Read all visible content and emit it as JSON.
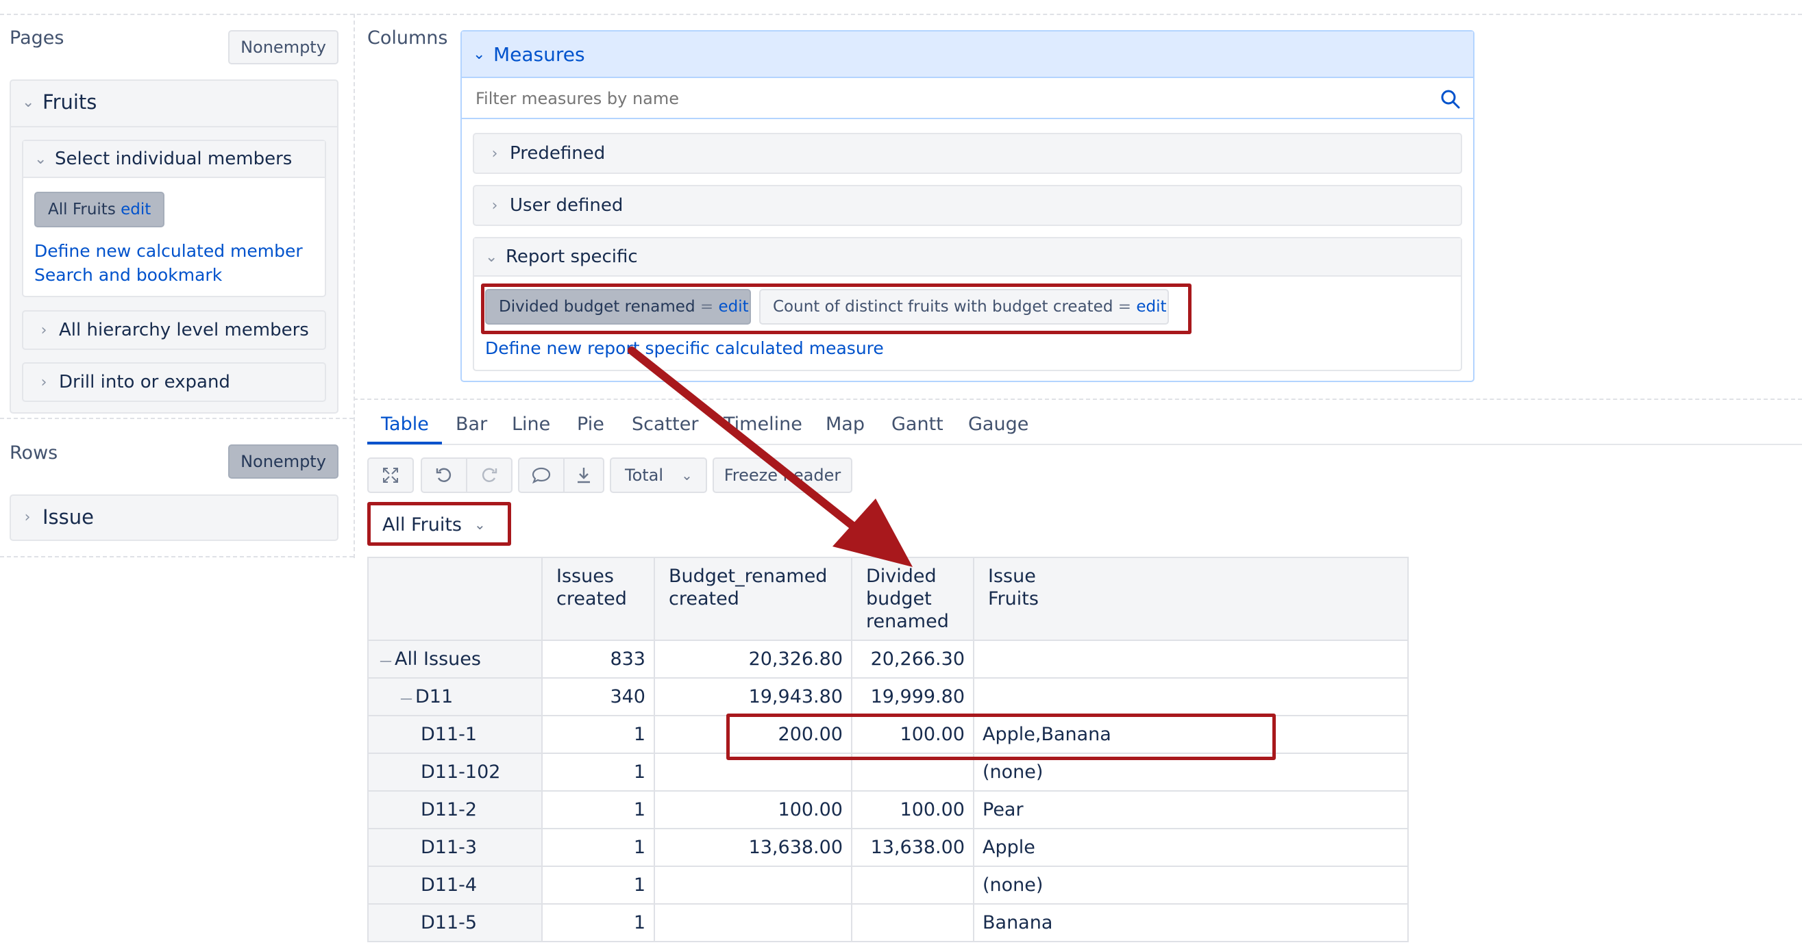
{
  "pages": {
    "label": "Pages",
    "nonempty": "Nonempty",
    "dimension": "Fruits",
    "select_members": "Select individual members",
    "member_tag": "All Fruits",
    "member_edit": "edit",
    "define_calc": "Define new calculated member",
    "search_bookmark": "Search and bookmark",
    "hierarchy_levels": "All hierarchy level members",
    "drill": "Drill into or expand"
  },
  "rows": {
    "label": "Rows",
    "nonempty": "Nonempty",
    "dimension": "Issue"
  },
  "columns": {
    "label": "Columns",
    "measures_title": "Measures",
    "filter_placeholder": "Filter measures by name",
    "predefined": "Predefined",
    "user_defined": "User defined",
    "report_specific": "Report specific",
    "measure1": "Divided budget renamed",
    "measure2": "Count of distinct fruits with budget created",
    "equals": "=",
    "edit": "edit",
    "define_measure": "Define new report specific calculated measure"
  },
  "view_tabs": [
    "Table",
    "Bar",
    "Line",
    "Pie",
    "Scatter",
    "Timeline",
    "Map",
    "Gantt",
    "Gauge"
  ],
  "toolbar": {
    "total": "Total",
    "freeze_header": "Freeze header",
    "page_selector": "All Fruits"
  },
  "table": {
    "headers": [
      [
        "Issues",
        "created"
      ],
      [
        "Budget_renamed",
        "created"
      ],
      [
        "Divided",
        "budget",
        "renamed"
      ],
      [
        "Issue",
        "Fruits"
      ]
    ],
    "rows": [
      {
        "label": "All Issues",
        "prefix": "—",
        "indent": 0,
        "issues": "833",
        "budget": "20,326.80",
        "divided": "20,266.30",
        "fruits": ""
      },
      {
        "label": "D11",
        "prefix": "—",
        "indent": 1,
        "issues": "340",
        "budget": "19,943.80",
        "divided": "19,999.80",
        "fruits": ""
      },
      {
        "label": "D11-1",
        "prefix": "",
        "indent": 2,
        "issues": "1",
        "budget": "200.00",
        "divided": "100.00",
        "fruits": "Apple,Banana"
      },
      {
        "label": "D11-102",
        "prefix": "",
        "indent": 2,
        "issues": "1",
        "budget": "",
        "divided": "",
        "fruits": "(none)"
      },
      {
        "label": "D11-2",
        "prefix": "",
        "indent": 2,
        "issues": "1",
        "budget": "100.00",
        "divided": "100.00",
        "fruits": "Pear"
      },
      {
        "label": "D11-3",
        "prefix": "",
        "indent": 2,
        "issues": "1",
        "budget": "13,638.00",
        "divided": "13,638.00",
        "fruits": "Apple"
      },
      {
        "label": "D11-4",
        "prefix": "",
        "indent": 2,
        "issues": "1",
        "budget": "",
        "divided": "",
        "fruits": "(none)"
      },
      {
        "label": "D11-5",
        "prefix": "",
        "indent": 2,
        "issues": "1",
        "budget": "",
        "divided": "",
        "fruits": "Banana"
      }
    ]
  },
  "colors": {
    "accent": "#0052cc",
    "annotation_red": "#a8181c",
    "measures_header_bg": "#deebff"
  }
}
